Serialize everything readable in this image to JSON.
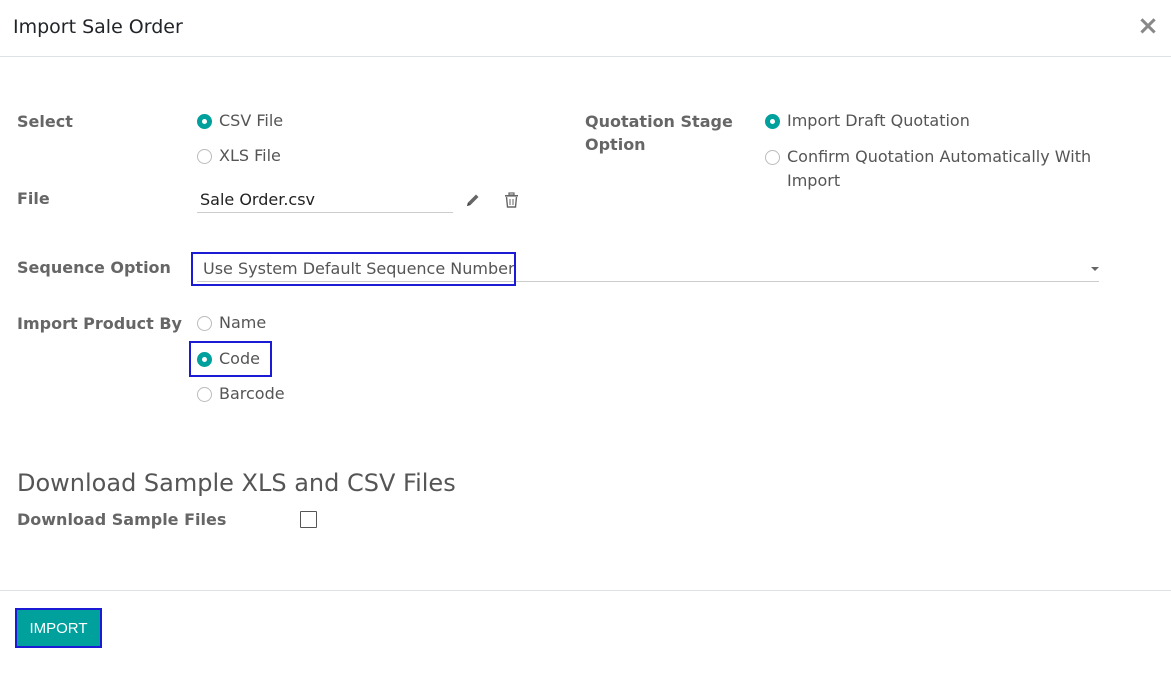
{
  "dialog": {
    "title": "Import Sale Order",
    "close_glyph": "×"
  },
  "form": {
    "select": {
      "label": "Select",
      "options": [
        {
          "label": "CSV File",
          "checked": true
        },
        {
          "label": "XLS File",
          "checked": false
        }
      ]
    },
    "file": {
      "label": "File",
      "value": "Sale Order.csv"
    },
    "quotation_stage": {
      "label_line1": "Quotation Stage",
      "label_line2": "Option",
      "options": [
        {
          "label": "Import Draft Quotation",
          "checked": true
        },
        {
          "label_line1": "Confirm Quotation Automatically With",
          "label_line2": "Import",
          "checked": false
        }
      ]
    },
    "sequence": {
      "label": "Sequence Option",
      "value": "Use System Default Sequence Number"
    },
    "import_product_by": {
      "label": "Import Product By",
      "options": [
        {
          "label": "Name",
          "checked": false
        },
        {
          "label": "Code",
          "checked": true
        },
        {
          "label": "Barcode",
          "checked": false
        }
      ]
    }
  },
  "sample": {
    "heading": "Download Sample XLS and CSV Files",
    "label": "Download Sample Files",
    "checked": false
  },
  "footer": {
    "import_label": "IMPORT"
  },
  "colors": {
    "accent": "#00a09d",
    "highlight": "#1b1bd6"
  },
  "icons": {
    "edit": "pencil-icon",
    "delete": "trash-icon"
  }
}
